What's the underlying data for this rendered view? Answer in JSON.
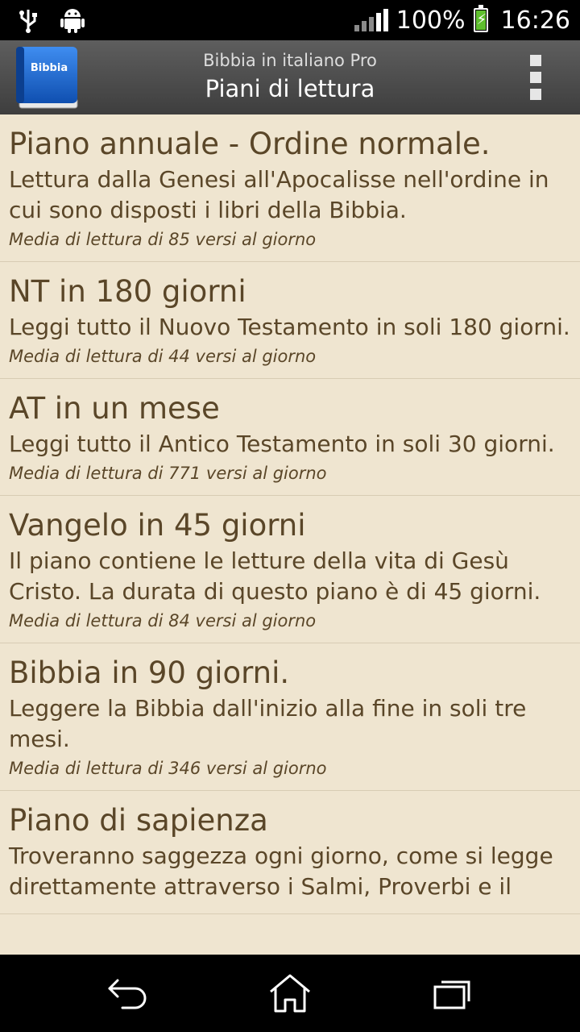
{
  "status_bar": {
    "battery_percent": "100%",
    "time": "16:26"
  },
  "action_bar": {
    "app_icon_label": "Bibbia",
    "app_name": "Bibbia in italiano Pro",
    "screen_title": "Piani di lettura"
  },
  "plans": [
    {
      "title": "Piano annuale - Ordine normale.",
      "description": "Lettura dalla Genesi all'Apocalisse nell'ordine in cui sono disposti i libri della Bibbia.",
      "stats": "Media di lettura di 85 versi al giorno"
    },
    {
      "title": "NT in 180 giorni",
      "description": "Leggi tutto il Nuovo Testamento in soli 180 giorni.",
      "stats": "Media di lettura di 44 versi al giorno"
    },
    {
      "title": "AT in un mese",
      "description": "Leggi tutto il Antico Testamento in soli 30 giorni.",
      "stats": "Media di lettura di 771 versi al giorno"
    },
    {
      "title": "Vangelo in 45 giorni",
      "description": "Il piano contiene le letture della vita di Gesù Cristo. La durata di questo piano è di 45 giorni.",
      "stats": "Media di lettura di 84 versi al giorno"
    },
    {
      "title": "Bibbia in 90 giorni.",
      "description": "Leggere la Bibbia dall'inizio alla fine in soli tre mesi.",
      "stats": "Media di lettura di 346 versi al giorno"
    },
    {
      "title": "Piano di sapienza",
      "description": "Troveranno saggezza ogni giorno, come si legge direttamente attraverso i Salmi, Proverbi e il",
      "stats": ""
    }
  ],
  "colors": {
    "list_background": "#efe5d0",
    "text": "#5a4628",
    "action_bar": "#4a4a4a",
    "book_blue": "#1f6fd8"
  }
}
